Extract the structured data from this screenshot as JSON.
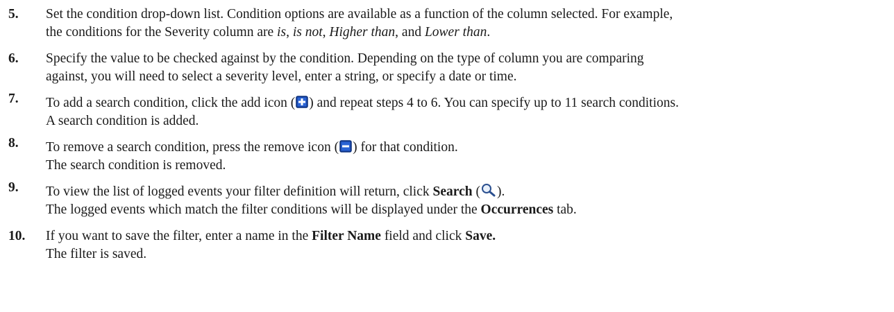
{
  "steps": [
    {
      "num": "5.",
      "l1a": "Set the condition drop-down list. Condition options are available as a function of the column selected. For example,",
      "l2a": "the conditions for the Severity column are ",
      "opt1": "is",
      "sep1": ", ",
      "opt2": "is not",
      "sep2": ", ",
      "opt3": "Higher than",
      "sep3": ", and ",
      "opt4": "Lower than",
      "end": "."
    },
    {
      "num": "6.",
      "l1": "Specify the value to be checked against by the condition. Depending on the type of column you are comparing",
      "l2": "against, you will need to select a severity level, enter a string, or specify a date or time."
    },
    {
      "num": "7.",
      "l1a": "To add a search condition, click the add icon (",
      "l1b": ") and repeat steps 4 to 6. You can specify up to 11 search conditions.",
      "l2": "A search condition is added.",
      "icon": "add-icon"
    },
    {
      "num": "8.",
      "l1a": "To remove a search condition, press the remove icon (",
      "l1b": ") for that condition.",
      "l2": "The search condition is removed.",
      "icon": "remove-icon"
    },
    {
      "num": "9.",
      "l1a": "To view the list of logged events your filter definition will return, click ",
      "l1bold": "Search",
      "l1b": " (",
      "l1c": ").",
      "l2a": "The logged events which match the filter conditions will be displayed under the ",
      "l2bold": "Occurrences",
      "l2b": " tab.",
      "icon": "search-icon"
    },
    {
      "num": "10.",
      "l1a": "If you want to save the filter, enter a name in the ",
      "l1bold1": "Filter Name",
      "l1b": " field and click ",
      "l1bold2": "Save.",
      "l2": "The filter is saved."
    }
  ],
  "colors": {
    "icon_blue": "#1f4fb4",
    "icon_border": "#0b2f7a",
    "text": "#1a1a1a"
  }
}
